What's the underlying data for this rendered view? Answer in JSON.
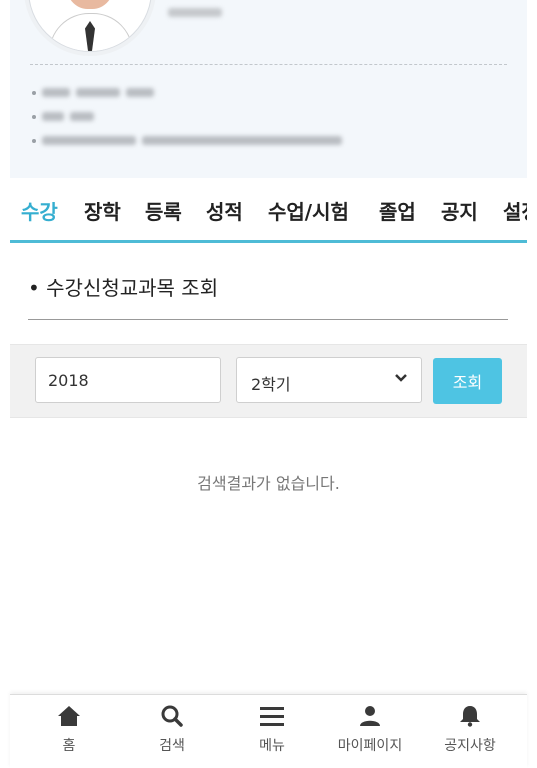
{
  "tabs": [
    "수강",
    "장학",
    "등록",
    "성적",
    "수업/시험",
    "졸업",
    "공지",
    "설정"
  ],
  "section_title": "• 수강신청교과목 조회",
  "search": {
    "year_value": "2018",
    "term_value": "2학기",
    "search_button": "조회"
  },
  "empty_message": "검색결과가 없습니다.",
  "bottom_nav": {
    "home": "홈",
    "search": "검색",
    "menu": "메뉴",
    "mypage": "마이페이지",
    "notice": "공지사항"
  },
  "colors": {
    "accent": "#35aed0",
    "button": "#4ec4e3",
    "profile_bg": "#f3f7fb"
  },
  "icons": [
    "home-icon",
    "search-icon",
    "menu-icon",
    "user-icon",
    "bell-icon",
    "chevron-down-icon"
  ]
}
